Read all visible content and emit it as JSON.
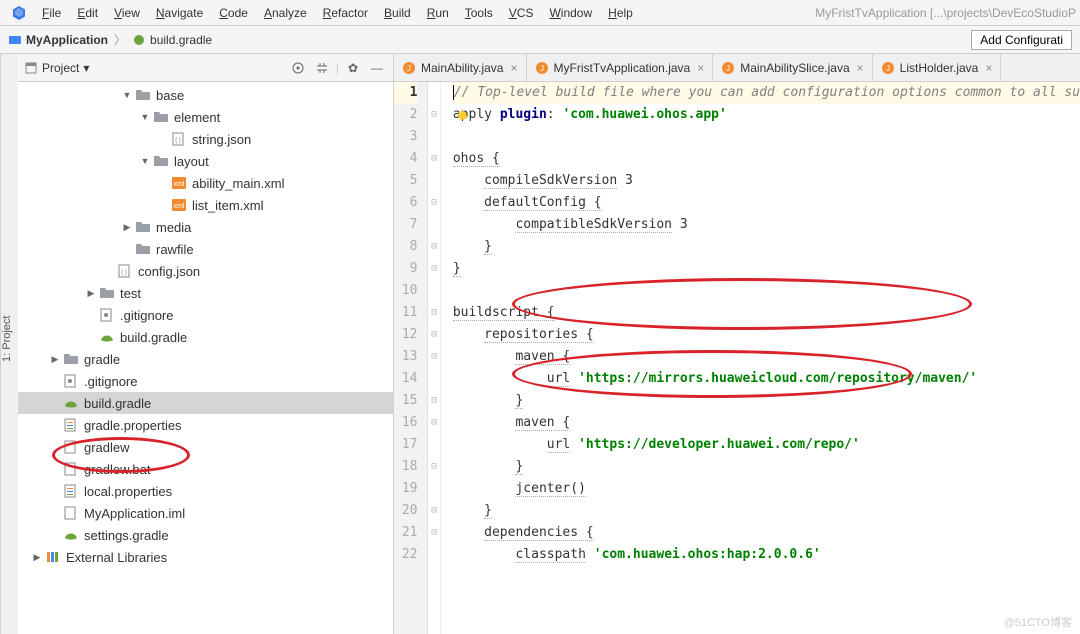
{
  "menu": {
    "items": [
      "File",
      "Edit",
      "View",
      "Navigate",
      "Code",
      "Analyze",
      "Refactor",
      "Build",
      "Run",
      "Tools",
      "VCS",
      "Window",
      "Help"
    ],
    "projectLabel": "MyFristTvApplication [...\\projects\\DevEcoStudioP"
  },
  "breadcrumb": {
    "root": "MyApplication",
    "file": "build.gradle"
  },
  "configButton": "Add Configurati",
  "sidebarTab": "1: Project",
  "projectPane": {
    "viewLabel": "Project"
  },
  "tree": {
    "items": [
      {
        "indent": 5,
        "expand": "down",
        "icon": "folder",
        "label": "base"
      },
      {
        "indent": 6,
        "expand": "down",
        "icon": "folder",
        "label": "element"
      },
      {
        "indent": 7,
        "expand": "",
        "icon": "json",
        "label": "string.json"
      },
      {
        "indent": 6,
        "expand": "down",
        "icon": "folder",
        "label": "layout"
      },
      {
        "indent": 7,
        "expand": "",
        "icon": "xml",
        "label": "ability_main.xml"
      },
      {
        "indent": 7,
        "expand": "",
        "icon": "xml",
        "label": "list_item.xml"
      },
      {
        "indent": 5,
        "expand": "right",
        "icon": "folder",
        "label": "media"
      },
      {
        "indent": 5,
        "expand": "",
        "icon": "folder",
        "label": "rawfile"
      },
      {
        "indent": 4,
        "expand": "",
        "icon": "json",
        "label": "config.json"
      },
      {
        "indent": 3,
        "expand": "right",
        "icon": "folder",
        "label": "test"
      },
      {
        "indent": 3,
        "expand": "",
        "icon": "git",
        "label": ".gitignore"
      },
      {
        "indent": 3,
        "expand": "",
        "icon": "gradle",
        "label": "build.gradle"
      },
      {
        "indent": 1,
        "expand": "right",
        "icon": "folder",
        "label": "gradle"
      },
      {
        "indent": 1,
        "expand": "",
        "icon": "git",
        "label": ".gitignore"
      },
      {
        "indent": 1,
        "expand": "",
        "icon": "gradle",
        "label": "build.gradle",
        "selected": true
      },
      {
        "indent": 1,
        "expand": "",
        "icon": "prop",
        "label": "gradle.properties"
      },
      {
        "indent": 1,
        "expand": "",
        "icon": "file",
        "label": "gradlew"
      },
      {
        "indent": 1,
        "expand": "",
        "icon": "file",
        "label": "gradlew.bat"
      },
      {
        "indent": 1,
        "expand": "",
        "icon": "prop",
        "label": "local.properties"
      },
      {
        "indent": 1,
        "expand": "",
        "icon": "file",
        "label": "MyApplication.iml"
      },
      {
        "indent": 1,
        "expand": "",
        "icon": "gradle",
        "label": "settings.gradle"
      },
      {
        "indent": 0,
        "expand": "right",
        "icon": "lib",
        "label": "External Libraries"
      }
    ]
  },
  "tabs": [
    {
      "icon": "java",
      "label": "MainAbility.java"
    },
    {
      "icon": "java",
      "label": "MyFristTvApplication.java"
    },
    {
      "icon": "java",
      "label": "MainAbilitySlice.java"
    },
    {
      "icon": "java",
      "label": "ListHolder.java"
    }
  ],
  "code": {
    "lines": [
      {
        "n": 1,
        "t": "comment",
        "text": "// Top-level build file where you can add configuration options common to all su"
      },
      {
        "n": 2,
        "t": "apply",
        "pre": "apply ",
        "kw": "plugin",
        "post": ": ",
        "str": "'com.huawei.ohos.app'"
      },
      {
        "n": 3,
        "t": "blank"
      },
      {
        "n": 4,
        "t": "plain",
        "text": "ohos {"
      },
      {
        "n": 5,
        "t": "kv",
        "indent": 1,
        "key": "compileSdkVersion",
        "val": "3"
      },
      {
        "n": 6,
        "t": "plain",
        "indent": 1,
        "text": "defaultConfig {"
      },
      {
        "n": 7,
        "t": "kv",
        "indent": 2,
        "key": "compatibleSdkVersion",
        "val": "3"
      },
      {
        "n": 8,
        "t": "plain",
        "indent": 1,
        "text": "}"
      },
      {
        "n": 9,
        "t": "plain",
        "text": "}"
      },
      {
        "n": 10,
        "t": "blank"
      },
      {
        "n": 11,
        "t": "plain",
        "text": "buildscript {"
      },
      {
        "n": 12,
        "t": "plain",
        "indent": 1,
        "text": "repositories {"
      },
      {
        "n": 13,
        "t": "plain",
        "indent": 2,
        "text": "maven {"
      },
      {
        "n": 14,
        "t": "kv2",
        "indent": 3,
        "key": "url",
        "str": "'https://mirrors.huaweicloud.com/repository/maven/'"
      },
      {
        "n": 15,
        "t": "plain",
        "indent": 2,
        "text": "}"
      },
      {
        "n": 16,
        "t": "plain",
        "indent": 2,
        "text": "maven {"
      },
      {
        "n": 17,
        "t": "kv2",
        "indent": 3,
        "key": "url",
        "str": "'https://developer.huawei.com/repo/'"
      },
      {
        "n": 18,
        "t": "plain",
        "indent": 2,
        "text": "}"
      },
      {
        "n": 19,
        "t": "plain",
        "indent": 2,
        "text": "jcenter()"
      },
      {
        "n": 20,
        "t": "plain",
        "indent": 1,
        "text": "}"
      },
      {
        "n": 21,
        "t": "plain",
        "indent": 1,
        "text": "dependencies {"
      },
      {
        "n": 22,
        "t": "kv2",
        "indent": 2,
        "key": "classpath",
        "str": "'com.huawei.ohos:hap:2.0.0.6'"
      }
    ]
  },
  "watermark": "@51CTO博客"
}
